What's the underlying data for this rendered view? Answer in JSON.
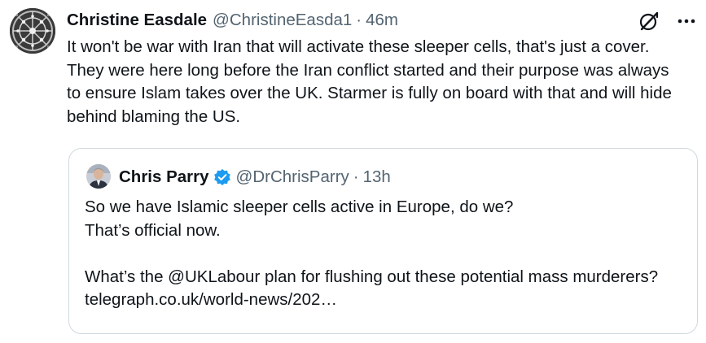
{
  "tweet": {
    "author": {
      "display_name": "Christine Easdale",
      "handle": "@ChristineEasda1",
      "avatar_icon": "profile-avatar"
    },
    "separator": "·",
    "time": "46m",
    "text": "It won't be war with Iran that will activate these sleeper cells, that's just a cover.  They were here long before the Iran conflict started and their purpose was always to ensure Islam takes over the UK. Starmer is fully on board with that and will hide behind blaming the US.",
    "icons": {
      "grok": "grok-icon",
      "more": "more-icon"
    }
  },
  "quoted_tweet": {
    "author": {
      "display_name": "Chris Parry",
      "handle": "@DrChrisParry",
      "verified": true,
      "verified_color": "#1d9bf0",
      "avatar_icon": "profile-avatar"
    },
    "separator": "·",
    "time": "13h",
    "lines": {
      "line1": "So we have Islamic sleeper cells active in Europe, do we?",
      "line2": "That’s official now.",
      "line3": "What’s the @UKLabour plan for flushing out these potential mass murderers? telegraph.co.uk/world-news/202…"
    }
  },
  "colors": {
    "text_primary": "#0f1419",
    "text_secondary": "#536471",
    "border": "#cfd9de",
    "accent": "#1d9bf0"
  }
}
